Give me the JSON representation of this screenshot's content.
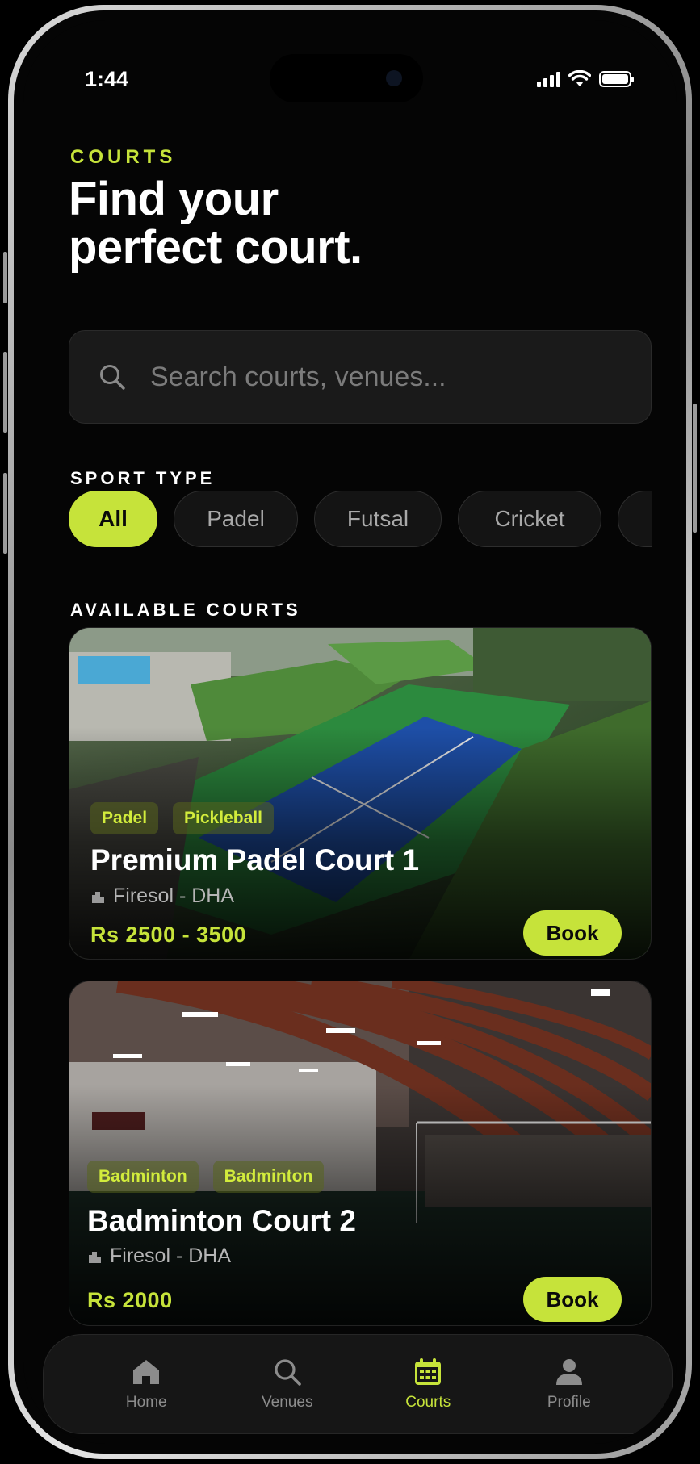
{
  "status_bar": {
    "time": "1:44"
  },
  "header": {
    "eyebrow": "COURTS",
    "title_line1": "Find your",
    "title_line2": "perfect court."
  },
  "search": {
    "placeholder": "Search courts, venues..."
  },
  "sport_type": {
    "label": "SPORT TYPE",
    "chips": [
      "All",
      "Padel",
      "Futsal",
      "Cricket",
      ""
    ],
    "selected": "All"
  },
  "available_courts": {
    "label": "AVAILABLE COURTS",
    "items": [
      {
        "tags": [
          "Padel",
          "Pickleball"
        ],
        "name": "Premium Padel Court 1",
        "venue": "Firesol - DHA",
        "price": "Rs 2500 - 3500",
        "book_label": "Book"
      },
      {
        "tags": [
          "Badminton",
          "Badminton"
        ],
        "name": "Badminton Court 2",
        "venue": "Firesol - DHA",
        "price": "Rs 2000",
        "book_label": "Book"
      }
    ]
  },
  "nav": {
    "items": [
      {
        "label": "Home",
        "icon": "home-icon"
      },
      {
        "label": "Venues",
        "icon": "search-icon"
      },
      {
        "label": "Courts",
        "icon": "calendar-icon"
      },
      {
        "label": "Profile",
        "icon": "user-icon"
      }
    ],
    "active": "Courts"
  },
  "colors": {
    "accent": "#c6e33a",
    "background": "#050505",
    "surface": "#1a1a1a"
  }
}
